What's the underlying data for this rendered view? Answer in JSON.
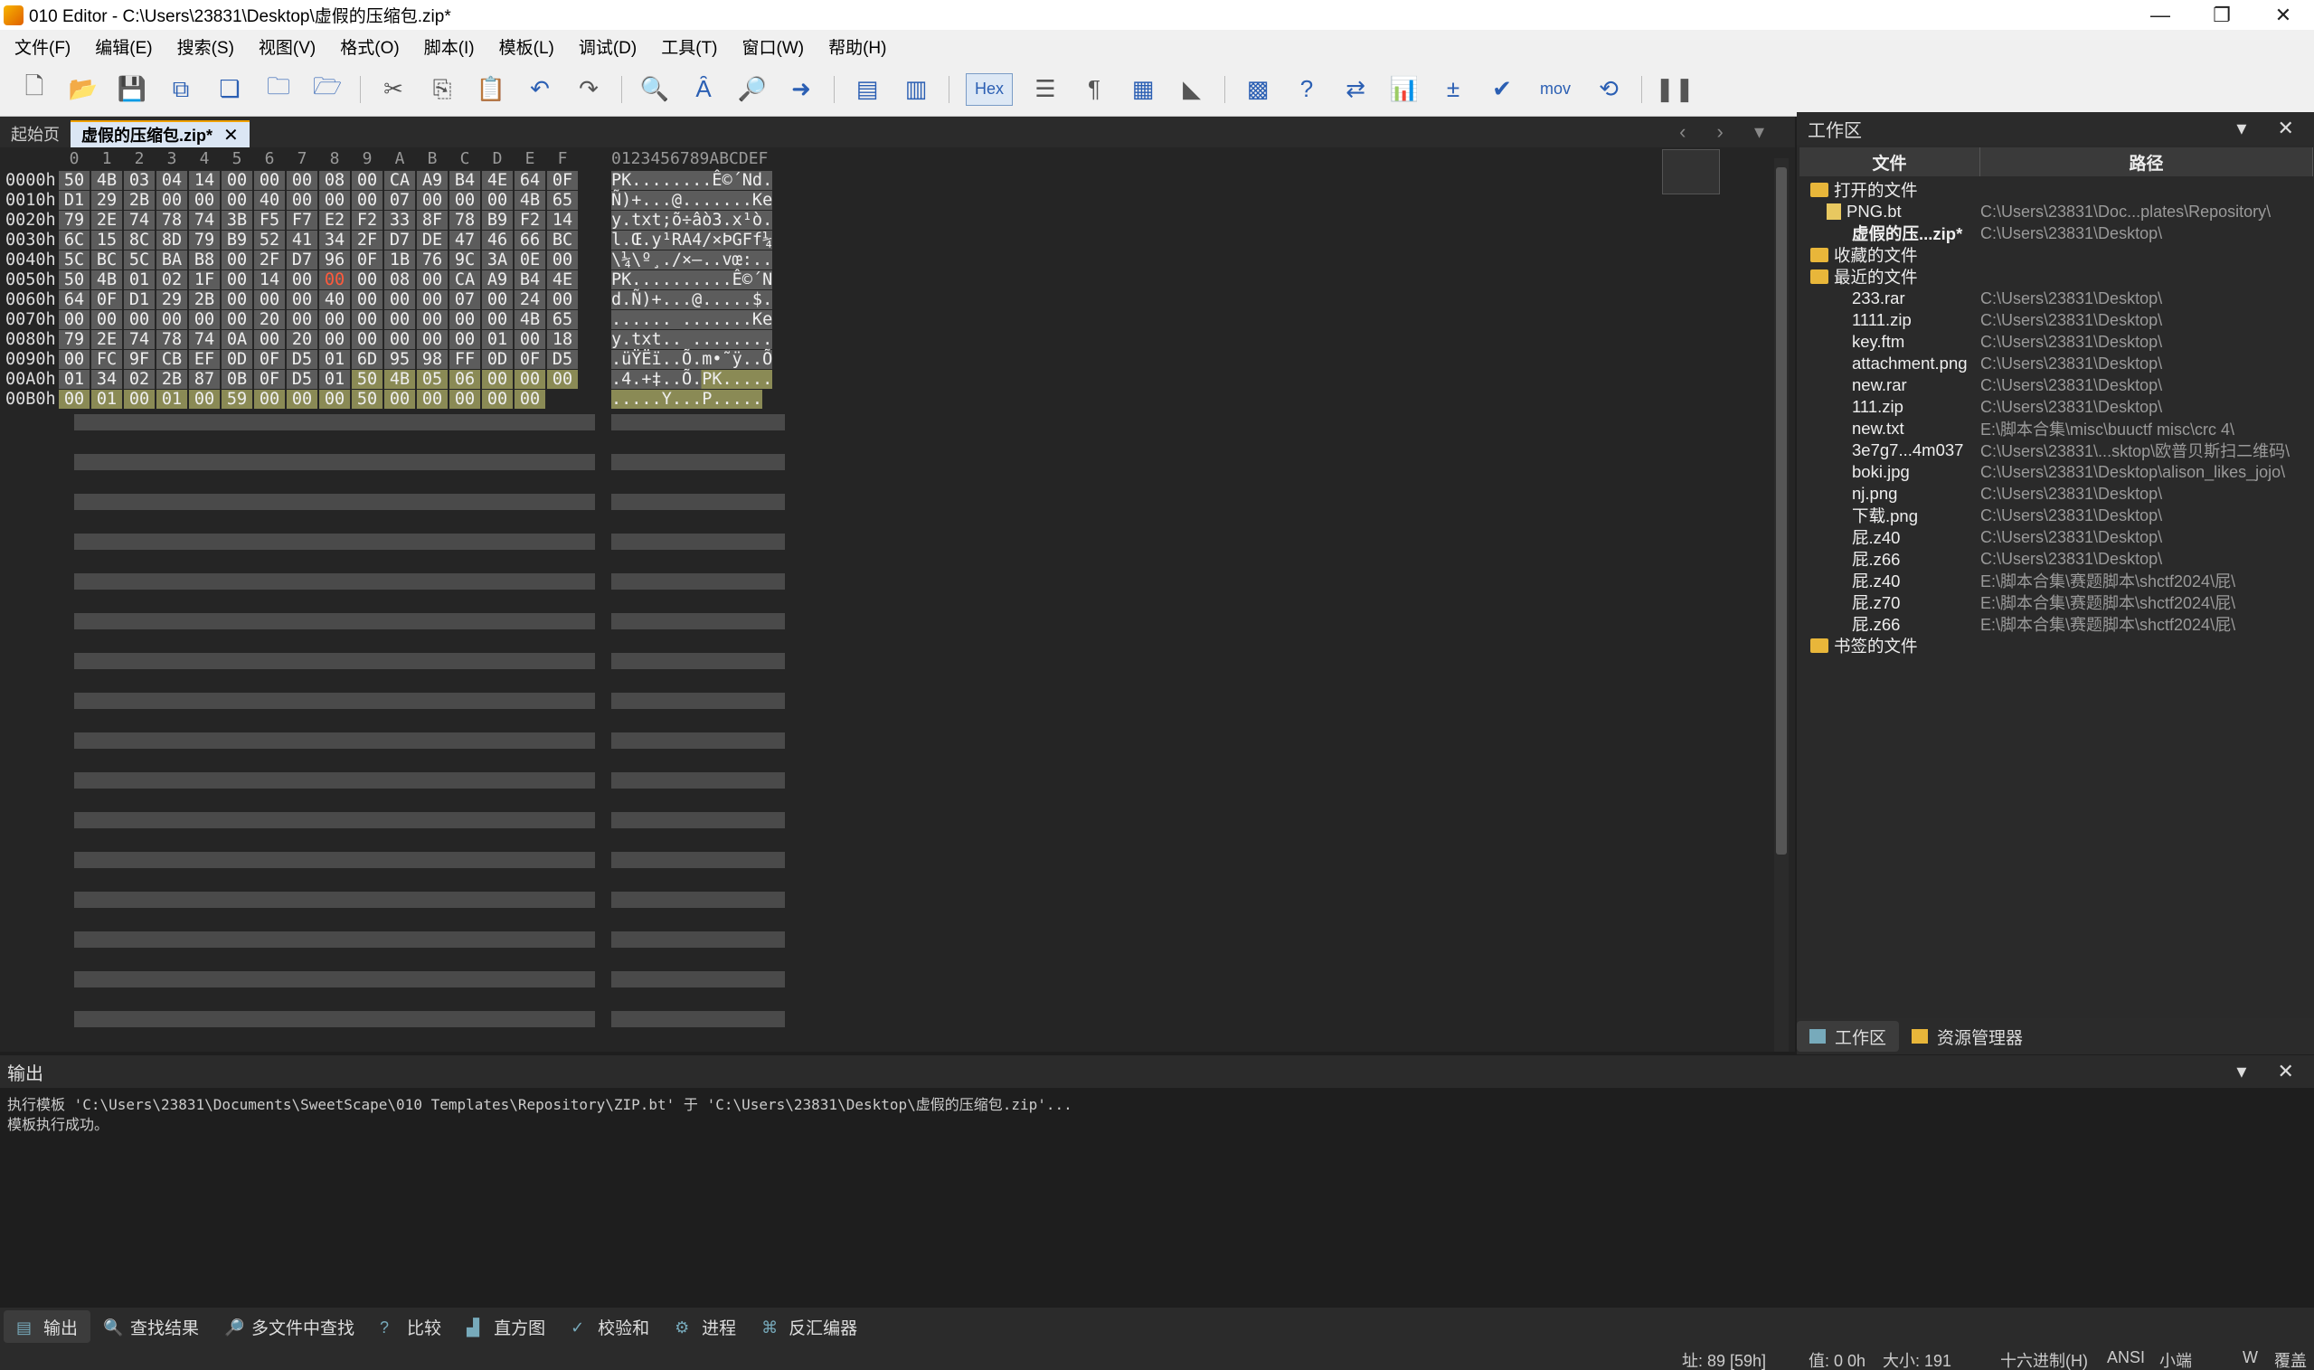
{
  "window": {
    "title": "010 Editor - C:\\Users\\23831\\Desktop\\虚假的压缩包.zip*",
    "min": "—",
    "restore": "❐",
    "close": "✕"
  },
  "menu": [
    "文件(F)",
    "编辑(E)",
    "搜索(S)",
    "视图(V)",
    "格式(O)",
    "脚本(I)",
    "模板(L)",
    "调试(D)",
    "工具(T)",
    "窗口(W)",
    "帮助(H)"
  ],
  "toolbar": {
    "hex_label": "Hex",
    "mov_label": "mov"
  },
  "tabs": {
    "start": "起始页",
    "active": "虚假的压缩包.zip*",
    "close": "✕",
    "nav": "‹ › ▾"
  },
  "hex": {
    "col_header": [
      "0",
      "1",
      "2",
      "3",
      "4",
      "5",
      "6",
      "7",
      "8",
      "9",
      "A",
      "B",
      "C",
      "D",
      "E",
      "F"
    ],
    "ascii_header": "0123456789ABCDEF",
    "rows": [
      {
        "offset": "0000h:",
        "bytes": [
          "50",
          "4B",
          "03",
          "04",
          "14",
          "00",
          "00",
          "00",
          "08",
          "00",
          "CA",
          "A9",
          "B4",
          "4E",
          "64",
          "0F"
        ],
        "ascii": "PK........Ê©´Nd."
      },
      {
        "offset": "0010h:",
        "bytes": [
          "D1",
          "29",
          "2B",
          "00",
          "00",
          "00",
          "40",
          "00",
          "00",
          "00",
          "07",
          "00",
          "00",
          "00",
          "4B",
          "65"
        ],
        "ascii": "Ñ)+...@.......Ke"
      },
      {
        "offset": "0020h:",
        "bytes": [
          "79",
          "2E",
          "74",
          "78",
          "74",
          "3B",
          "F5",
          "F7",
          "E2",
          "F2",
          "33",
          "8F",
          "78",
          "B9",
          "F2",
          "14"
        ],
        "ascii": "y.txt;õ÷âò3.x¹ò."
      },
      {
        "offset": "0030h:",
        "bytes": [
          "6C",
          "15",
          "8C",
          "8D",
          "79",
          "B9",
          "52",
          "41",
          "34",
          "2F",
          "D7",
          "DE",
          "47",
          "46",
          "66",
          "BC"
        ],
        "ascii": "l.Œ.y¹RA4/×ÞGFf¼"
      },
      {
        "offset": "0040h:",
        "bytes": [
          "5C",
          "BC",
          "5C",
          "BA",
          "B8",
          "00",
          "2F",
          "D7",
          "96",
          "0F",
          "1B",
          "76",
          "9C",
          "3A",
          "0E",
          "00"
        ],
        "ascii": "\\¼\\º¸./×–..vœ:.."
      },
      {
        "offset": "0050h:",
        "bytes": [
          "50",
          "4B",
          "01",
          "02",
          "1F",
          "00",
          "14",
          "00",
          "00",
          "00",
          "08",
          "00",
          "CA",
          "A9",
          "B4",
          "4E"
        ],
        "ascii": "PK..........Ê©´N"
      },
      {
        "offset": "0060h:",
        "bytes": [
          "64",
          "0F",
          "D1",
          "29",
          "2B",
          "00",
          "00",
          "00",
          "40",
          "00",
          "00",
          "00",
          "07",
          "00",
          "24",
          "00"
        ],
        "ascii": "d.Ñ)+...@.....$."
      },
      {
        "offset": "0070h:",
        "bytes": [
          "00",
          "00",
          "00",
          "00",
          "00",
          "00",
          "20",
          "00",
          "00",
          "00",
          "00",
          "00",
          "00",
          "00",
          "4B",
          "65"
        ],
        "ascii": "...... .......Ke"
      },
      {
        "offset": "0080h:",
        "bytes": [
          "79",
          "2E",
          "74",
          "78",
          "74",
          "0A",
          "00",
          "20",
          "00",
          "00",
          "00",
          "00",
          "00",
          "01",
          "00",
          "18"
        ],
        "ascii": "y.txt.. ........"
      },
      {
        "offset": "0090h:",
        "bytes": [
          "00",
          "FC",
          "9F",
          "CB",
          "EF",
          "0D",
          "0F",
          "D5",
          "01",
          "6D",
          "95",
          "98",
          "FF",
          "0D",
          "0F",
          "D5"
        ],
        "ascii": ".üŸËï..Õ.m•˜ÿ..Õ"
      },
      {
        "offset": "00A0h:",
        "bytes": [
          "01",
          "34",
          "02",
          "2B",
          "87",
          "0B",
          "0F",
          "D5",
          "01",
          "50",
          "4B",
          "05",
          "06",
          "00",
          "00",
          "00"
        ],
        "ascii": ".4.+‡..Õ.PK....."
      },
      {
        "offset": "00B0h:",
        "bytes": [
          "00",
          "01",
          "00",
          "01",
          "00",
          "59",
          "00",
          "00",
          "00",
          "50",
          "00",
          "00",
          "00",
          "00",
          "00",
          ""
        ],
        "ascii": ".....Y...P....."
      }
    ]
  },
  "workspace": {
    "title": "工作区",
    "ctrl": "▾ ✕",
    "col_file": "文件",
    "col_path": "路径",
    "groups": {
      "open": "打开的文件",
      "favorites": "收藏的文件",
      "recent": "最近的文件",
      "bookmarks": "书签的文件"
    },
    "open_files": [
      {
        "name": "PNG.bt",
        "path": "C:\\Users\\23831\\Doc...plates\\Repository\\"
      },
      {
        "name": "虚假的压...zip*",
        "path": "C:\\Users\\23831\\Desktop\\"
      }
    ],
    "recent_files": [
      {
        "name": "233.rar",
        "path": "C:\\Users\\23831\\Desktop\\"
      },
      {
        "name": "1111.zip",
        "path": "C:\\Users\\23831\\Desktop\\"
      },
      {
        "name": "key.ftm",
        "path": "C:\\Users\\23831\\Desktop\\"
      },
      {
        "name": "attachment.png",
        "path": "C:\\Users\\23831\\Desktop\\"
      },
      {
        "name": "new.rar",
        "path": "C:\\Users\\23831\\Desktop\\"
      },
      {
        "name": "111.zip",
        "path": "C:\\Users\\23831\\Desktop\\"
      },
      {
        "name": "new.txt",
        "path": "E:\\脚本合集\\misc\\buuctf misc\\crc 4\\"
      },
      {
        "name": "3e7g7...4m037",
        "path": "C:\\Users\\23831\\...sktop\\欧普贝斯扫二维码\\"
      },
      {
        "name": "boki.jpg",
        "path": "C:\\Users\\23831\\Desktop\\alison_likes_jojo\\"
      },
      {
        "name": "nj.png",
        "path": "C:\\Users\\23831\\Desktop\\"
      },
      {
        "name": "下载.png",
        "path": "C:\\Users\\23831\\Desktop\\"
      },
      {
        "name": "屁.z40",
        "path": "C:\\Users\\23831\\Desktop\\"
      },
      {
        "name": "屁.z66",
        "path": "C:\\Users\\23831\\Desktop\\"
      },
      {
        "name": "屁.z40",
        "path": "E:\\脚本合集\\赛题脚本\\shctf2024\\屁\\"
      },
      {
        "name": "屁.z70",
        "path": "E:\\脚本合集\\赛题脚本\\shctf2024\\屁\\"
      },
      {
        "name": "屁.z66",
        "path": "E:\\脚本合集\\赛题脚本\\shctf2024\\屁\\"
      }
    ],
    "tab_workspace": "工作区",
    "tab_explorer": "资源管理器"
  },
  "output": {
    "title": "输出",
    "ctrl": "▾ ✕",
    "lines": [
      "执行模板 'C:\\Users\\23831\\Documents\\SweetScape\\010 Templates\\Repository\\ZIP.bt' 于 'C:\\Users\\23831\\Desktop\\虚假的压缩包.zip'...",
      "模板执行成功。"
    ]
  },
  "bottom_tabs": [
    "输出",
    "查找结果",
    "多文件中查找",
    "比较",
    "直方图",
    "校验和",
    "进程",
    "反汇编器"
  ],
  "status": {
    "addr": "址: 89 [59h]",
    "value": "值: 0 0h",
    "size": "大小: 191",
    "mode": "十六进制(H)",
    "encoding": "ANSI",
    "endian": "小端",
    "w": "W",
    "overwrite": "覆盖"
  }
}
